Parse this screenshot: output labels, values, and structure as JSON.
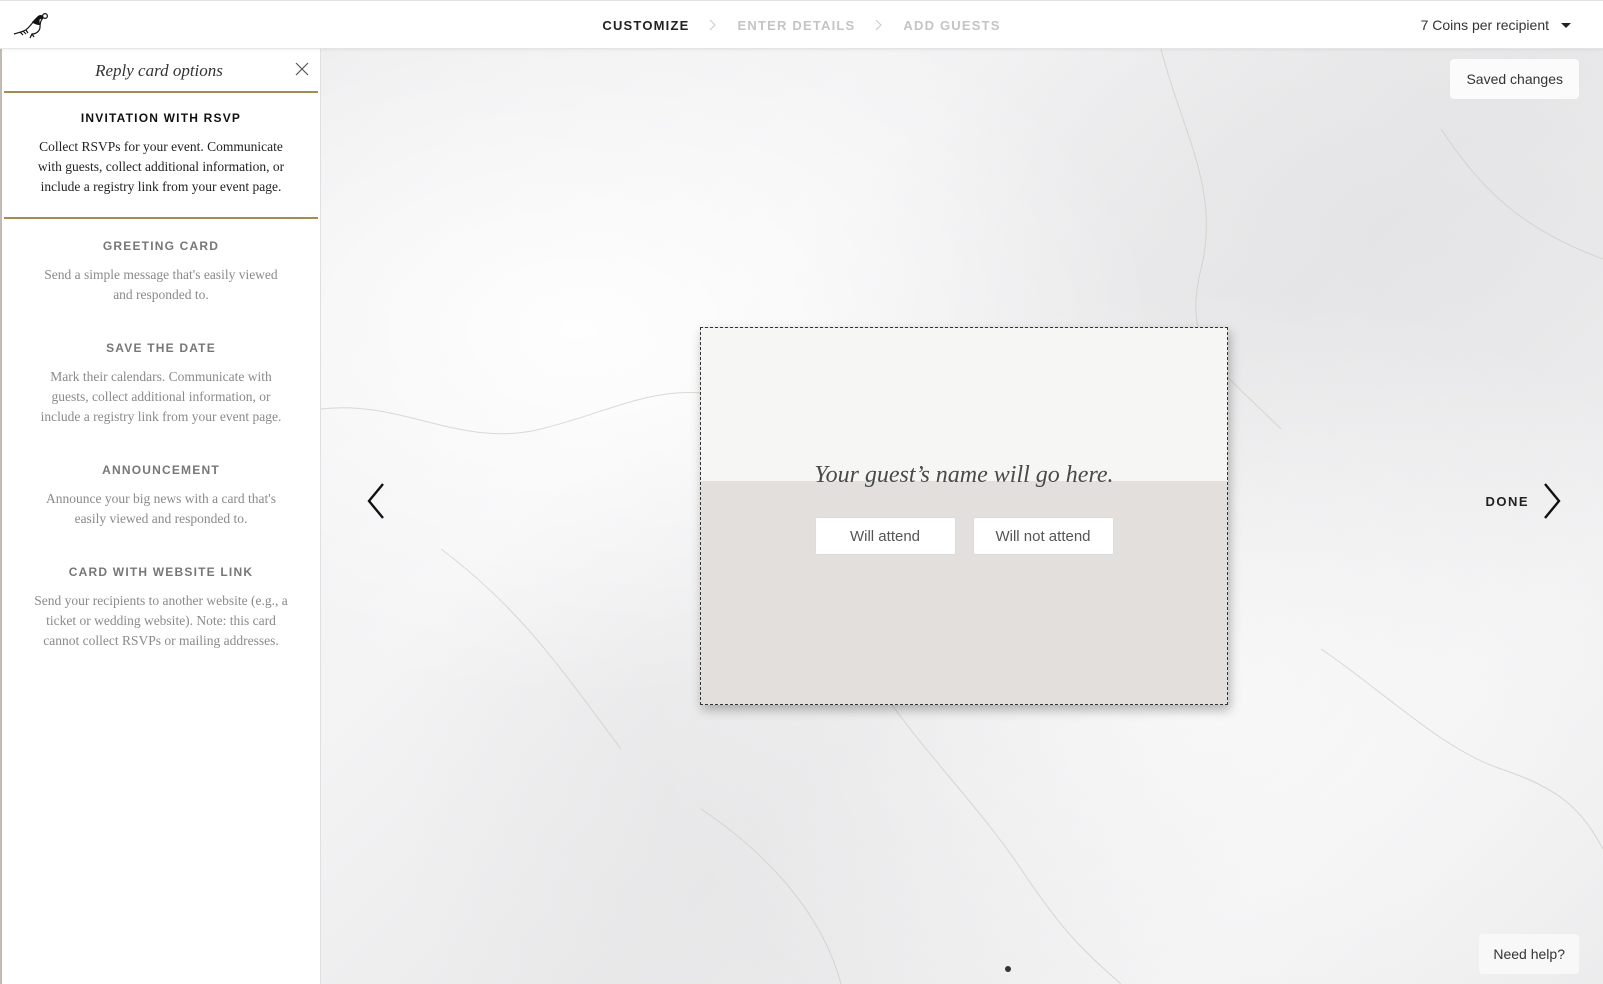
{
  "header": {
    "logo": "pigeon-logo",
    "steps": [
      {
        "label": "CUSTOMIZE",
        "active": true
      },
      {
        "label": "ENTER DETAILS",
        "active": false
      },
      {
        "label": "ADD GUESTS",
        "active": false
      }
    ],
    "coins_label": "7 Coins per recipient"
  },
  "sidebar": {
    "title": "Reply card options",
    "options": [
      {
        "title": "INVITATION WITH RSVP",
        "description": "Collect RSVPs for your event. Communicate with guests, collect additional information, or include a registry link from your event page.",
        "selected": true
      },
      {
        "title": "GREETING CARD",
        "description": "Send a simple message that's easily viewed and responded to.",
        "selected": false
      },
      {
        "title": "SAVE THE DATE",
        "description": "Mark their calendars. Communicate with guests, collect additional information, or include a registry link from your event page.",
        "selected": false
      },
      {
        "title": "ANNOUNCEMENT",
        "description": "Announce your big news with a card that's easily viewed and responded to.",
        "selected": false
      },
      {
        "title": "CARD WITH WEBSITE LINK",
        "description": "Send your recipients to another website (e.g., a ticket or wedding website). Note: this card cannot collect RSVPs or mailing addresses.",
        "selected": false
      }
    ]
  },
  "canvas": {
    "saved_label": "Saved changes",
    "done_label": "DONE",
    "help_label": "Need help?",
    "card": {
      "guest_placeholder": "Your guest’s name will go here.",
      "attend_label": "Will attend",
      "not_attend_label": "Will not attend"
    },
    "page_indicator": {
      "current": 1,
      "total": 1
    }
  },
  "colors": {
    "accent": "#a88a55",
    "card_bottom": "#e2dfdc",
    "card_top": "#f6f6f5"
  }
}
